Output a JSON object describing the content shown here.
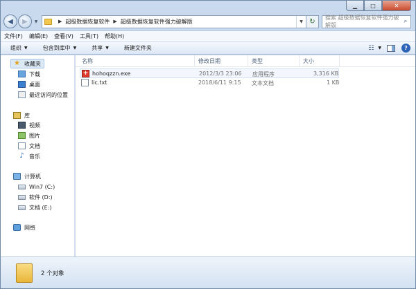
{
  "window": {
    "caption_buttons": [
      "minimize",
      "maximize",
      "close"
    ]
  },
  "address_bar": {
    "breadcrumbs": [
      "超级数据恢复软件",
      "超级数据恢复软件强力破解版"
    ],
    "search_placeholder": "搜索 超级数据恢复软件强力破解版"
  },
  "menubar": {
    "items": [
      "文件(F)",
      "编辑(E)",
      "查看(V)",
      "工具(T)",
      "帮助(H)"
    ]
  },
  "toolbar": {
    "organize": "组织",
    "include_in_library": "包含到库中",
    "share": "共享",
    "new_folder": "新建文件夹"
  },
  "navpane": {
    "favorites": {
      "label": "收藏夹",
      "items": [
        "下载",
        "桌面",
        "最近访问的位置"
      ]
    },
    "libraries": {
      "label": "库",
      "items": [
        "视频",
        "图片",
        "文档",
        "音乐"
      ]
    },
    "computer": {
      "label": "计算机",
      "items": [
        "Win7 (C:)",
        "软件 (D:)",
        "文档 (E:)"
      ]
    },
    "network": {
      "label": "网络"
    }
  },
  "columns": {
    "name": "名称",
    "modified": "修改日期",
    "type": "类型",
    "size": "大小"
  },
  "files": [
    {
      "name": "hohoqzzn.exe",
      "modified": "2012/3/3 23:06",
      "type": "应用程序",
      "size": "3,316 KB",
      "icon": "exe-icon"
    },
    {
      "name": "lic.txt",
      "modified": "2018/6/11 9:15",
      "type": "文本文档",
      "size": "1 KB",
      "icon": "txt-icon"
    }
  ],
  "statusbar": {
    "item_count": "2 个对象"
  },
  "colors": {
    "chrome": "#c9daee",
    "selection": "#dce9f7",
    "close_button": "#c94a2e"
  }
}
